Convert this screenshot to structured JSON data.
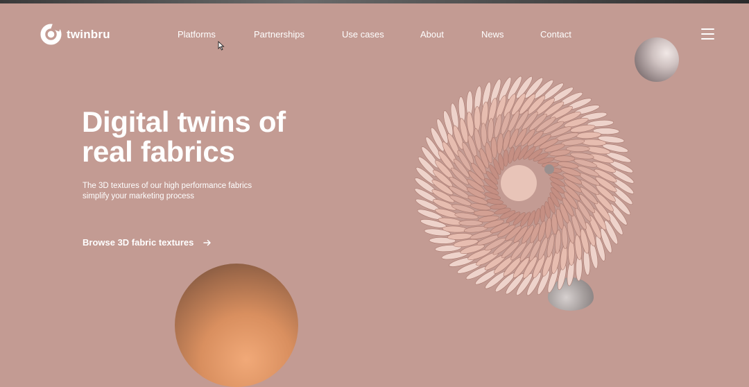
{
  "brand": {
    "name": "twinbru",
    "logo_icon": "twinbru-logo-icon"
  },
  "nav": {
    "items": [
      {
        "label": "Platforms"
      },
      {
        "label": "Partnerships"
      },
      {
        "label": "Use cases"
      },
      {
        "label": "About"
      },
      {
        "label": "News"
      },
      {
        "label": "Contact"
      }
    ],
    "menu_icon": "hamburger-menu-icon"
  },
  "hero": {
    "headline_line1": "Digital twins of",
    "headline_line2": "real fabrics",
    "subtitle_line1": "The 3D textures of our high performance fabrics",
    "subtitle_line2": "simplify your marketing process",
    "cta_label": "Browse 3D fabric textures",
    "cta_icon": "arrow-right-icon"
  },
  "colors": {
    "background": "#c39b93",
    "text": "#ffffff",
    "orange_sphere": "#d98f5f",
    "fabric_pink": "#f2cfc2"
  }
}
